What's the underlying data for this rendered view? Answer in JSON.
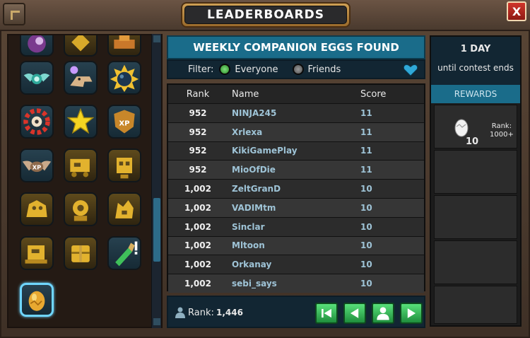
{
  "window": {
    "title": "LEADERBOARDS",
    "close_label": "X"
  },
  "leaderboard": {
    "header": "WEEKLY COMPANION EGGS FOUND",
    "filter": {
      "label": "Filter:",
      "options": [
        {
          "label": "Everyone",
          "selected": true
        },
        {
          "label": "Friends",
          "selected": false
        }
      ]
    },
    "columns": {
      "rank": "Rank",
      "name": "Name",
      "score": "Score"
    },
    "rows": [
      {
        "rank": "952",
        "name": "NINJA245",
        "score": "11"
      },
      {
        "rank": "952",
        "name": "Xrlexa",
        "score": "11"
      },
      {
        "rank": "952",
        "name": "KikiGamePlay",
        "score": "11"
      },
      {
        "rank": "952",
        "name": "MioOfDie",
        "score": "11"
      },
      {
        "rank": "1,002",
        "name": "ZeltGranD",
        "score": "10"
      },
      {
        "rank": "1,002",
        "name": "VADIMtm",
        "score": "10"
      },
      {
        "rank": "1,002",
        "name": "Sinclar",
        "score": "10"
      },
      {
        "rank": "1,002",
        "name": "Mltoon",
        "score": "10"
      },
      {
        "rank": "1,002",
        "name": "Orkanay",
        "score": "10"
      },
      {
        "rank": "1,002",
        "name": "sebi_says",
        "score": "10"
      }
    ],
    "footer": {
      "rank_label": "Rank:",
      "rank_value": "1,446"
    }
  },
  "contest": {
    "time_left": "1 DAY",
    "time_sub": "until contest ends",
    "rewards_label": "REWARDS",
    "reward": {
      "count": "10",
      "rank_line1": "Rank:",
      "rank_line2": "1000+"
    }
  },
  "icons": [
    "purple-orb-icon",
    "gold-emblem-icon",
    "orange-crest-icon",
    "winged-orb-icon",
    "dino-skull-icon",
    "bomb-icon",
    "red-gear-icon",
    "star-icon",
    "xp-shield-icon",
    "xp-wings-icon",
    "gold-truck-icon",
    "gold-robot-icon",
    "gold-beast-icon",
    "gold-mech-icon",
    "gold-golem-icon",
    "gold-tank-icon",
    "gold-chest-icon",
    "potion-icon",
    "companion-egg-icon"
  ],
  "colors": {
    "header_blue": "#1a6c8a",
    "nav_green": "#2fbf5a",
    "close_red": "#c0302a",
    "selected_border": "#6fd6ff"
  }
}
